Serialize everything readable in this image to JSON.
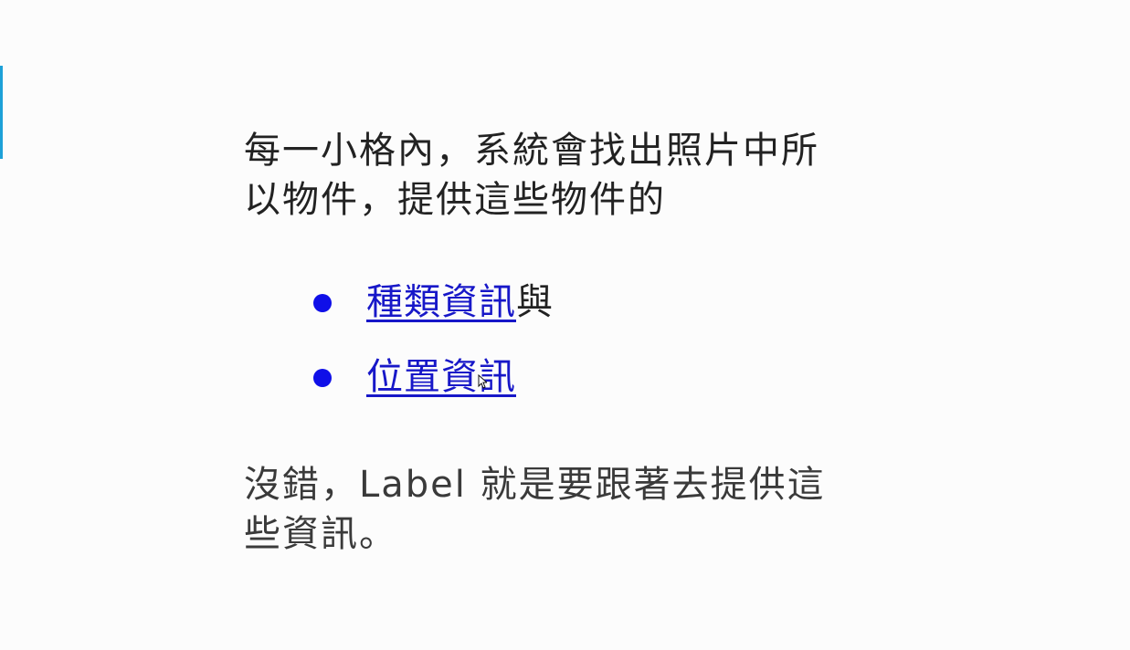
{
  "slide": {
    "accent_color": "#1da1d8",
    "link_color": "#1717c8",
    "bullet_color": "#0f0fe8",
    "intro_text": "每一小格內，系統會找出照片中所以物件，提供這些物件的",
    "bullets": [
      {
        "link_text": "種類資訊",
        "suffix": "與"
      },
      {
        "link_text": "位置資訊",
        "suffix": ""
      }
    ],
    "closing_text": "沒錯，Label 就是要跟著去提供這些資訊。"
  }
}
